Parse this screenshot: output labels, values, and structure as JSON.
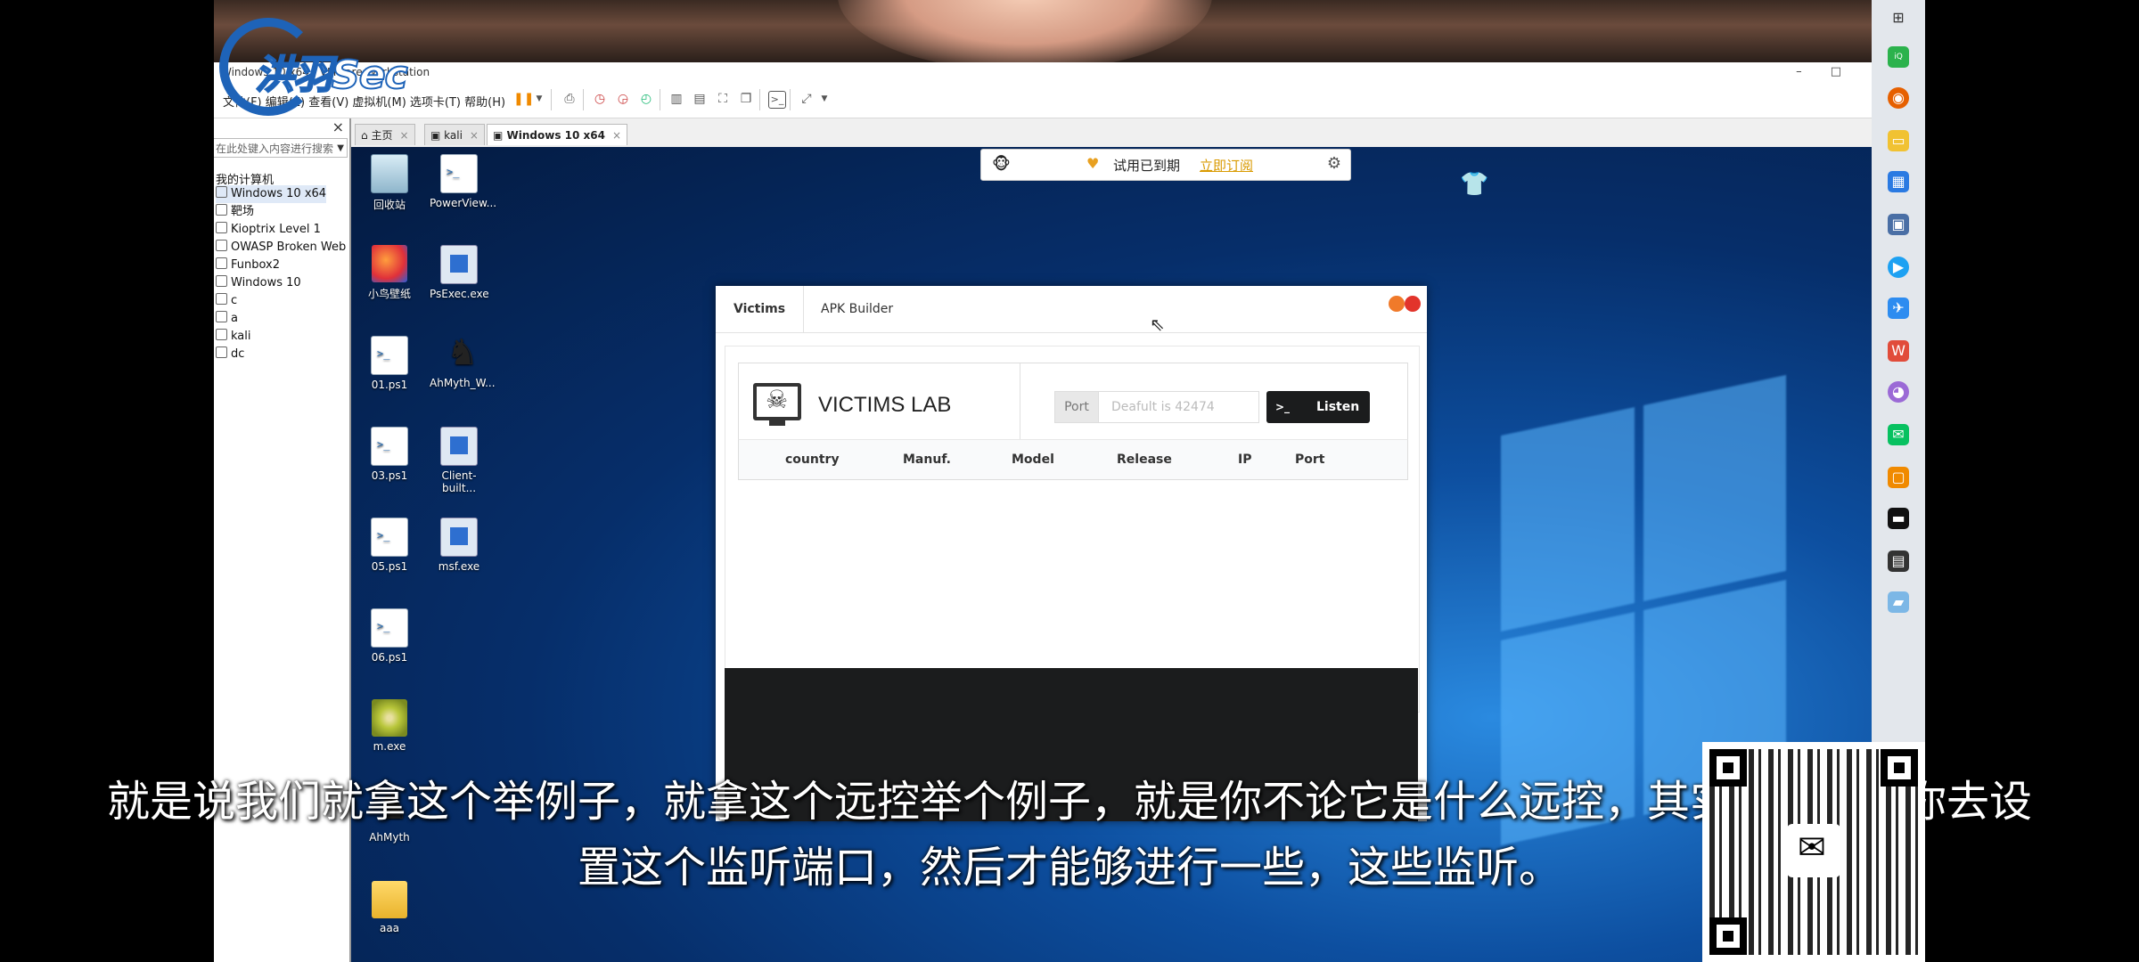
{
  "vmware": {
    "title": "Windows 10 x64 - VMware Workstation",
    "menu": "文件(F)  编辑(E)  查看(V)  虚拟机(M)  选项卡(T)  帮助(H)",
    "window_controls": "– □"
  },
  "library": {
    "close": "×",
    "search_placeholder": "在此处键入内容进行搜索",
    "root": "我的计算机",
    "items": [
      "Windows 10 x64",
      "靶场",
      "Kioptrix Level 1",
      "OWASP Broken Web",
      "Funbox2",
      "Windows 10",
      "c",
      "a",
      "kali",
      "dc"
    ]
  },
  "tabs": [
    {
      "label": "主页",
      "close": "×"
    },
    {
      "label": "kali",
      "close": "×"
    },
    {
      "label": "Windows 10 x64",
      "close": "×"
    }
  ],
  "trial_bar": {
    "face": "🐵",
    "heart": "♥",
    "expired": "试用已到期",
    "subscribe": "立即订阅",
    "settings": "⚙"
  },
  "desktop_icons": [
    {
      "label": "回收站",
      "glyph": "recycle-bin-icon"
    },
    {
      "label": "PowerView...",
      "glyph": "powershell-script-icon"
    },
    {
      "label": "小鸟壁纸",
      "glyph": "wallpaper-app-icon"
    },
    {
      "label": "PsExec.exe",
      "glyph": "exe-icon"
    },
    {
      "label": "01.ps1",
      "glyph": "powershell-script-icon"
    },
    {
      "label": "AhMyth_W...",
      "glyph": "ahmyth-icon"
    },
    {
      "label": "03.ps1",
      "glyph": "powershell-script-icon"
    },
    {
      "label": "Client-built...",
      "glyph": "exe-icon"
    },
    {
      "label": "05.ps1",
      "glyph": "powershell-script-icon"
    },
    {
      "label": "msf.exe",
      "glyph": "exe-icon"
    },
    {
      "label": "06.ps1",
      "glyph": "powershell-script-icon"
    },
    {
      "label": "m.exe",
      "glyph": "kiwi-icon"
    },
    {
      "label": "AhMyth",
      "glyph": "ahmyth-icon"
    },
    {
      "label": "aaa",
      "glyph": "folder-icon"
    }
  ],
  "app": {
    "tabs": [
      "Victims",
      "APK Builder"
    ],
    "lab_title": "VICTIMS LAB",
    "port_label": "Port",
    "port_placeholder": "Deafult is 42474",
    "listen_prompt": ">_",
    "listen_label": "Listen",
    "columns": [
      "country",
      "Manuf.",
      "Model",
      "Release",
      "IP",
      "Port"
    ],
    "dot_colors": [
      "#f07a2a",
      "#e2342b"
    ]
  },
  "logo": {
    "text": "洪羽Sec"
  },
  "subtitles": {
    "line1": "就是说我们就拿这个举例子，就拿这个远控举个例子，就是你不论它是什么远控，其实它都需要你去设",
    "line2": "置这个监听端口，然后才能够进行一些，这些监听。"
  },
  "colors": {
    "accent": "#1e63b8",
    "console_bg": "#1b1c1d",
    "trial_link": "#d99a00"
  }
}
